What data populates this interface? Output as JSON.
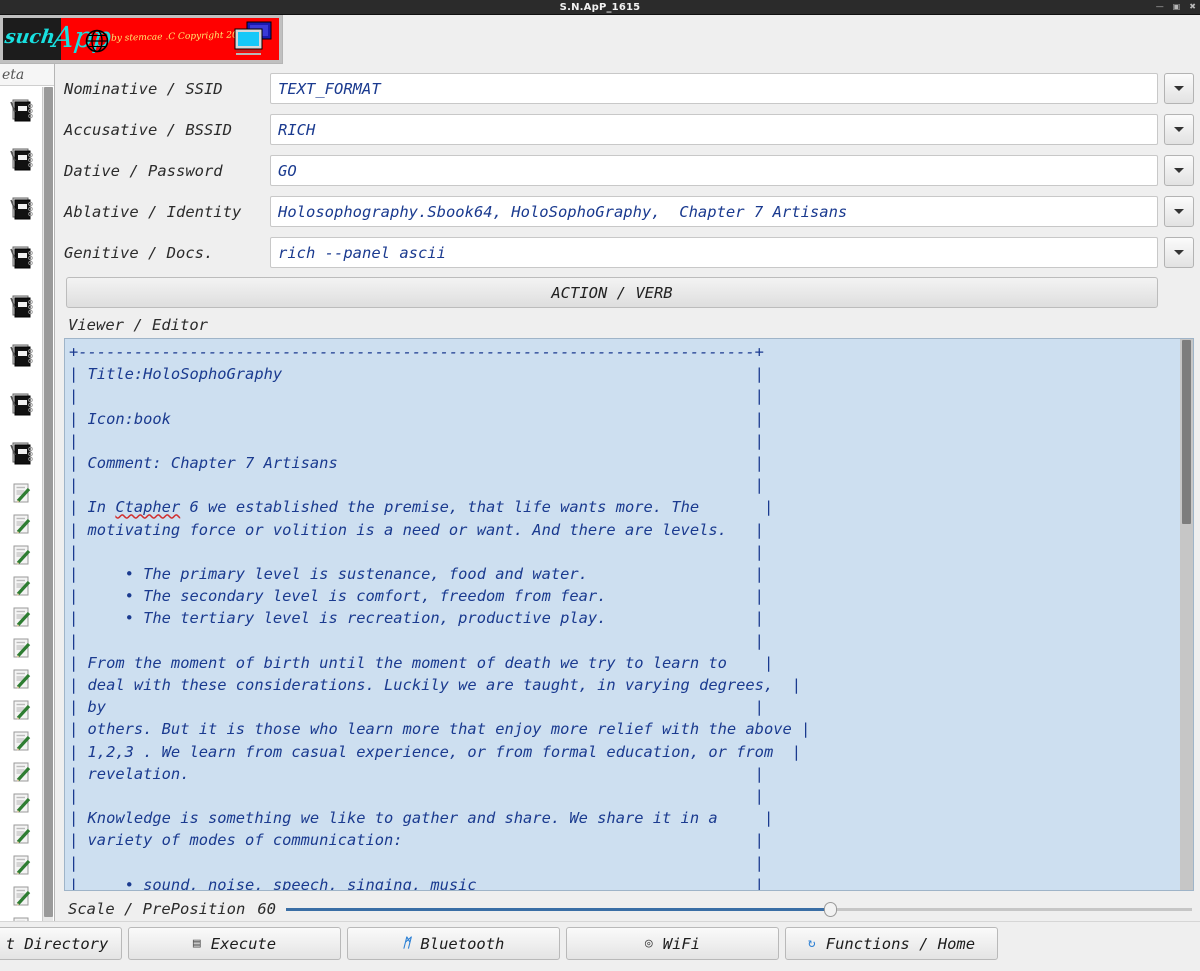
{
  "window": {
    "title": "S.N.ApP_1615",
    "controls": [
      {
        "name": "minimize",
        "glyph": "—"
      },
      {
        "name": "maximize",
        "glyph": "▣"
      },
      {
        "name": "close",
        "glyph": "✖"
      }
    ]
  },
  "banner": {
    "word_such": "such",
    "word_app": "App",
    "credit": "by stemcae .C Copyright 2020",
    "icons": [
      "globe-icon",
      "monitor-icon"
    ],
    "bg_color": "#ff0000",
    "text_color": "#18e0e0",
    "credit_color": "#ffe870"
  },
  "sidebar": {
    "header_label": "eta",
    "book_item_count": 8,
    "doc_item_count": 16,
    "book_icon": "notebook-icon",
    "doc_icon": "document-pencil-icon"
  },
  "form": {
    "fields": [
      {
        "label": "Nominative / SSID",
        "value": "TEXT_FORMAT",
        "placeholder": ""
      },
      {
        "label": "Accusative / BSSID",
        "value": "RICH",
        "placeholder": ""
      },
      {
        "label": "Dative / Password",
        "value": "GO",
        "placeholder": ""
      },
      {
        "label": "Ablative / Identity",
        "value": "Holosophography.Sbook64, HoloSophoGraphy,  Chapter 7 Artisans",
        "placeholder": ""
      },
      {
        "label": "Genitive / Docs.",
        "value": "rich --panel ascii",
        "placeholder": ""
      }
    ],
    "dropdown_icon": "chevron-down-icon"
  },
  "action_bar": {
    "label": "ACTION / VERB"
  },
  "viewer": {
    "label": "Viewer / Editor",
    "bg_color": "#cddff0",
    "text_color": "#1a3a8f",
    "content_pre": "+-------------------------------------------------------------------------+\n| Title:HoloSophoGraphy                                                   |\n|                                                                         |\n| Icon:book                                                               |\n|                                                                         |\n| Comment: Chapter 7 Artisans                                             |\n|                                                                         |\n| In ",
    "misspelled_word": "Ctapher",
    "content_post": " 6 we established the premise, that life wants more. The       |\n| motivating force or volition is a need or want. And there are levels.   |\n|                                                                         |\n|     • The primary level is sustenance, food and water.                  |\n|     • The secondary level is comfort, freedom from fear.                |\n|     • The tertiary level is recreation, productive play.                |\n|                                                                         |\n| From the moment of birth until the moment of death we try to learn to    |\n| deal with these considerations. Luckily we are taught, in varying degrees,  |\n| by                                                                      |\n| others. But it is those who learn more that enjoy more relief with the above |\n| 1,2,3 . We learn from casual experience, or from formal education, or from  |\n| revelation.                                                             |\n|                                                                         |\n| Knowledge is something we like to gather and share. We share it in a     |\n| variety of modes of communication:                                      |\n|                                                                         |\n|     • sound, noise, speech, singing, music                              |"
  },
  "slider": {
    "label": "Scale / PrePosition",
    "value": "60",
    "percent": 60,
    "fill_color": "#3a6ea5"
  },
  "bottom_toolbar": {
    "buttons": [
      {
        "label": "t Directory",
        "icon": "",
        "icon_name": "none"
      },
      {
        "label": "Execute",
        "icon": "▤",
        "icon_name": "execute-icon"
      },
      {
        "label": "Bluetooth",
        "icon": "ᛗ",
        "icon_name": "bluetooth-icon"
      },
      {
        "label": "WiFi",
        "icon": "◎",
        "icon_name": "wifi-icon"
      },
      {
        "label": "Functions / Home",
        "icon": "↻",
        "icon_name": "refresh-icon"
      }
    ]
  }
}
